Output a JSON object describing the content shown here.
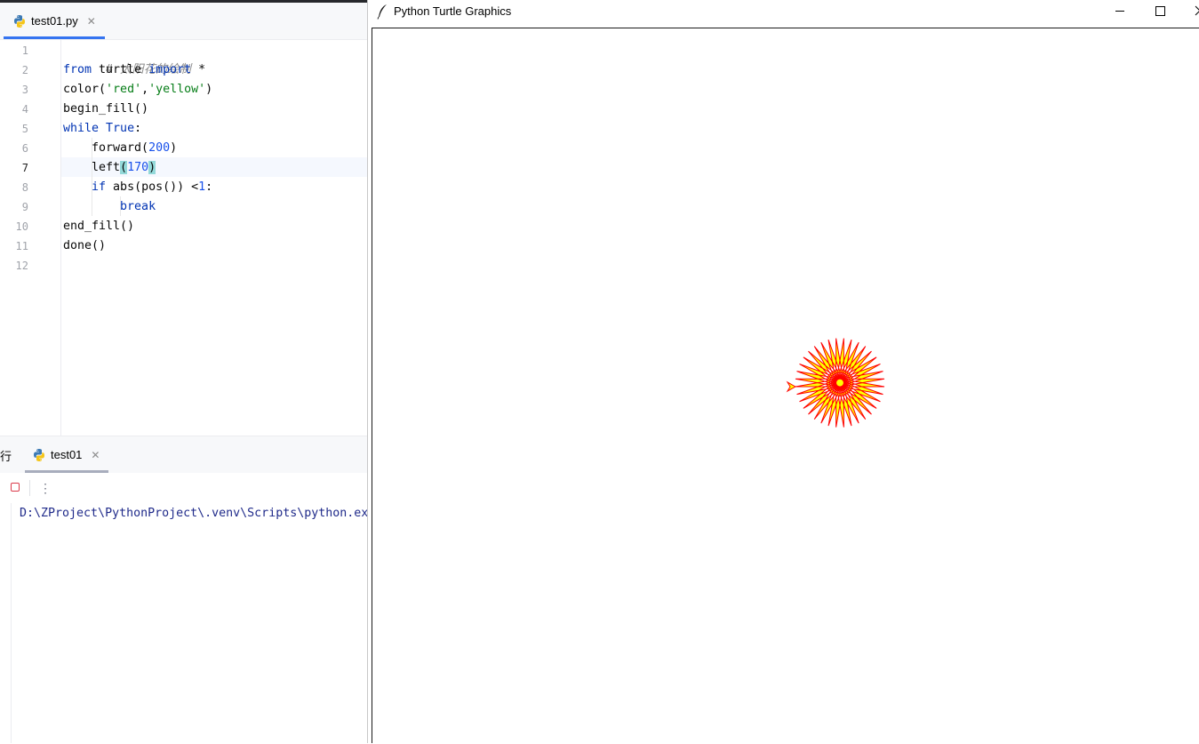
{
  "ide": {
    "editor_tab": {
      "label": "test01.py",
      "close": "✕"
    },
    "line_numbers": [
      "1",
      "2",
      "3",
      "4",
      "5",
      "6",
      "7",
      "8",
      "9",
      "10",
      "11",
      "12"
    ],
    "code": {
      "l1": {
        "comment": "# 太阳花的绘制"
      },
      "l2": {
        "from": "from",
        "module": " turtle ",
        "import": "import",
        "star": " *"
      },
      "l3": {
        "fn": "color(",
        "s1": "'red'",
        "comma": ",",
        "s2": "'yellow'",
        "close": ")"
      },
      "l4": {
        "text": "begin_fill()"
      },
      "l5": {
        "kw": "while",
        "sp": " ",
        "val": "True",
        "colon": ":"
      },
      "l6": {
        "fn": "    forward(",
        "num": "200",
        "close": ")"
      },
      "l7": {
        "fn": "    left",
        "open": "(",
        "num": "170",
        "close": ")"
      },
      "l8": {
        "kw": "    if",
        "mid": " abs(pos()) <",
        "num": "1",
        "colon": ":"
      },
      "l9": {
        "kw": "        break"
      },
      "l10": {
        "text": "end_fill()"
      },
      "l11": {
        "text": "done()"
      }
    },
    "run_panel": {
      "label": "行",
      "tab_label": "test01",
      "tab_close": "✕",
      "more": "⋮",
      "console_line": "D:\\ZProject\\PythonProject\\.venv\\Scripts\\python.exe"
    }
  },
  "turtle_window": {
    "title": "Python Turtle Graphics",
    "drawing": {
      "pen_color": "#ff0000",
      "fill_color": "#ffff00",
      "forward": 200,
      "left_angle": 170,
      "turtle_shape": "classic-arrow"
    }
  }
}
